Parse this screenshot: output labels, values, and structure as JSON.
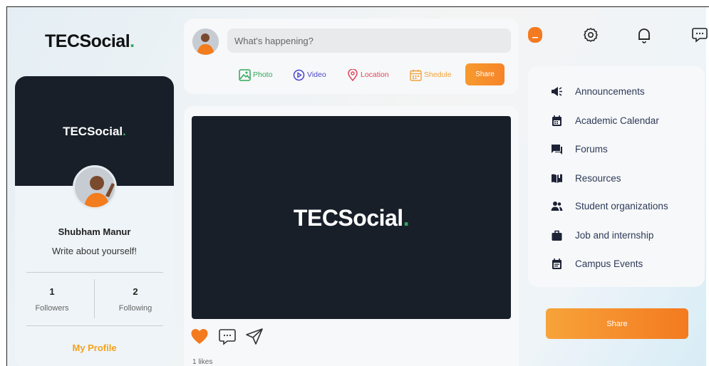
{
  "app": {
    "brand_main": "TECSocial",
    "brand_dot": "."
  },
  "profile": {
    "name": "Shubham Manur",
    "bio": "Write about yourself!",
    "followers_count": "1",
    "followers_label": "Followers",
    "following_count": "2",
    "following_label": "Following",
    "my_profile_label": "My Profile"
  },
  "composer": {
    "placeholder": "What's happening?",
    "actions": [
      {
        "label": "Photo",
        "icon": "image-icon",
        "color": "#2fa85a"
      },
      {
        "label": "Video",
        "icon": "play-circle-icon",
        "color": "#4a47c9"
      },
      {
        "label": "Location",
        "icon": "location-pin-icon",
        "color": "#e0455a"
      },
      {
        "label": "Shedule",
        "icon": "calendar-icon",
        "color": "#f2a23a"
      }
    ],
    "share_label": "Share"
  },
  "post": {
    "media_brand": "TECSocial",
    "media_dot": ".",
    "likes_text": "1 likes",
    "icons": [
      "heart-icon",
      "comment-icon",
      "send-icon"
    ]
  },
  "topbar": {
    "icons": [
      "user-avatar-icon",
      "settings-icon",
      "notification-bell-icon",
      "messages-icon"
    ],
    "accent": "#f47a20"
  },
  "nav": {
    "items": [
      {
        "label": "Announcements",
        "icon": "megaphone-icon"
      },
      {
        "label": "Academic Calendar",
        "icon": "calendar-icon"
      },
      {
        "label": "Forums",
        "icon": "forum-icon"
      },
      {
        "label": "Resources",
        "icon": "book-icon"
      },
      {
        "label": "Student organizations",
        "icon": "group-icon"
      },
      {
        "label": "Job and internship",
        "icon": "briefcase-icon"
      },
      {
        "label": "Campus Events",
        "icon": "event-icon"
      }
    ]
  },
  "share_button_label": "Share"
}
